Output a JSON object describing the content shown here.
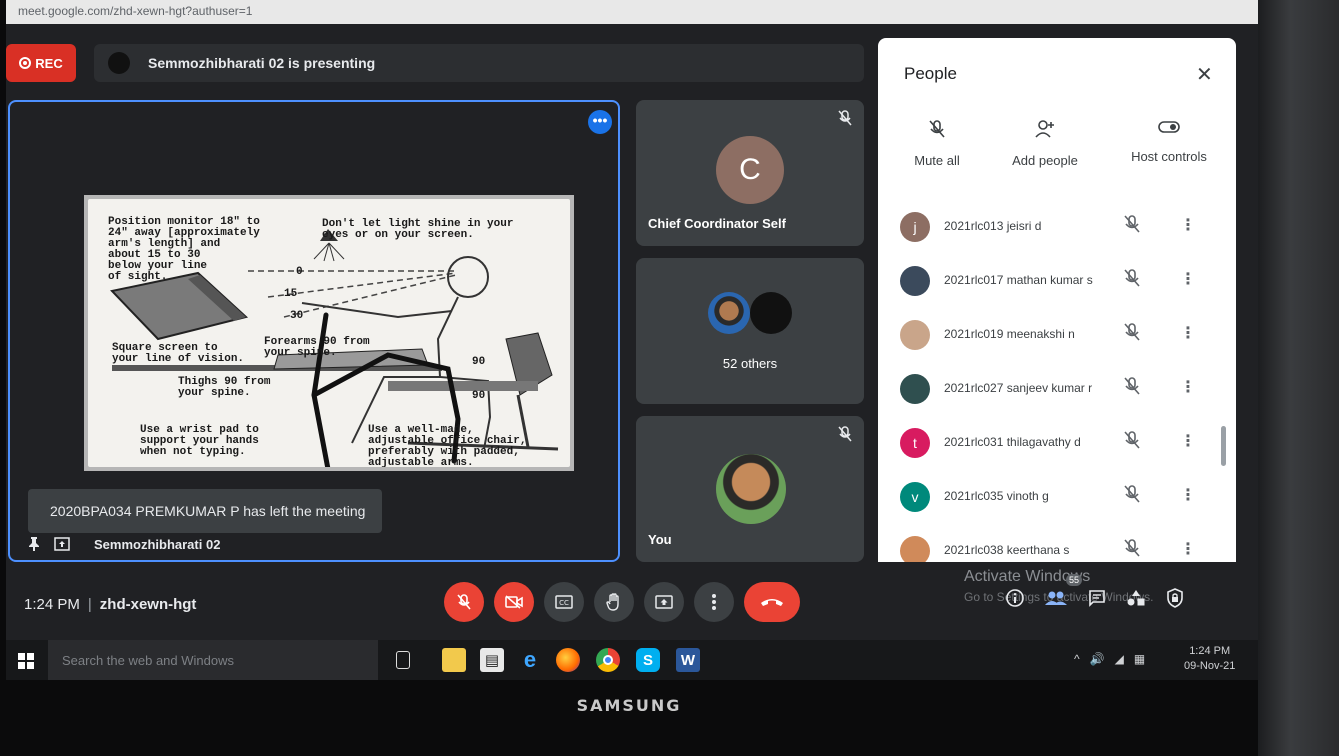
{
  "browser": {
    "url": "meet.google.com/zhd-xewn-hgt?authuser=1"
  },
  "header": {
    "rec_label": "REC",
    "presenting_text": "Semmozhibharati 02 is presenting"
  },
  "presentation": {
    "more_label": "•••",
    "slide_text": {
      "top_left": "Position monitor 18\" to\n24\" away [approximately\narm's length] and\nabout 15 to 30\nbelow your line\nof sight.",
      "top_right": "Don't let light shine in your\neyes or on your screen.",
      "angle_0": "0",
      "angle_15": "15",
      "angle_30": "30",
      "square": "Square screen to\nyour line of vision.",
      "forearms": "Forearms 90 from\nyour spine.",
      "thighs": "Thighs 90 from\nyour spine.",
      "deg_90a": "90",
      "deg_90b": "90",
      "wrist": "Use a wrist pad to\nsupport your hands\nwhen not typing.",
      "chair": "Use a well-made,\nadjustable office chair,\npreferably with padded,\nadjustable arms."
    },
    "toast": "2020BPA034 PREMKUMAR P has left the meeting",
    "presenter_label": "Semmozhibharati 02"
  },
  "tiles": {
    "chief": {
      "initial": "C",
      "name": "Chief Coordinator Self"
    },
    "others": {
      "label": "52 others"
    },
    "you": {
      "name": "You"
    }
  },
  "people_panel": {
    "title": "People",
    "actions": [
      "Mute all",
      "Add people",
      "Host controls"
    ],
    "participants": [
      {
        "name": "2021rlc013 jeisri d",
        "initial": "j",
        "color": "#8d6e63"
      },
      {
        "name": "2021rlc017 mathan kumar s",
        "initial": "",
        "color": "#3b4a5c"
      },
      {
        "name": "2021rlc019 meenakshi n",
        "initial": "",
        "color": "#c9a58a"
      },
      {
        "name": "2021rlc027 sanjeev kumar r",
        "initial": "",
        "color": "#2f4f4f"
      },
      {
        "name": "2021rlc031 thilagavathy d",
        "initial": "t",
        "color": "#d81b60"
      },
      {
        "name": "2021rlc035 vinoth g",
        "initial": "v",
        "color": "#00897b"
      },
      {
        "name": "2021rlc038 keerthana s",
        "initial": "",
        "color": "#d08a5a"
      }
    ]
  },
  "bottom_bar": {
    "time": "1:24 PM",
    "meeting_code": "zhd-xewn-hgt",
    "activate_title": "Activate Windows",
    "activate_sub": "Go to Settings to activate Windows.",
    "participant_count": "55"
  },
  "taskbar": {
    "search_placeholder": "Search the web and Windows",
    "time": "1:24 PM",
    "date": "09-Nov-21"
  },
  "monitor": {
    "brand": "SAMSUNG"
  },
  "colors": {
    "accent_blue": "#1a73e8",
    "red": "#ea4335",
    "tile_bg": "#3c4043",
    "bg": "#202124"
  }
}
